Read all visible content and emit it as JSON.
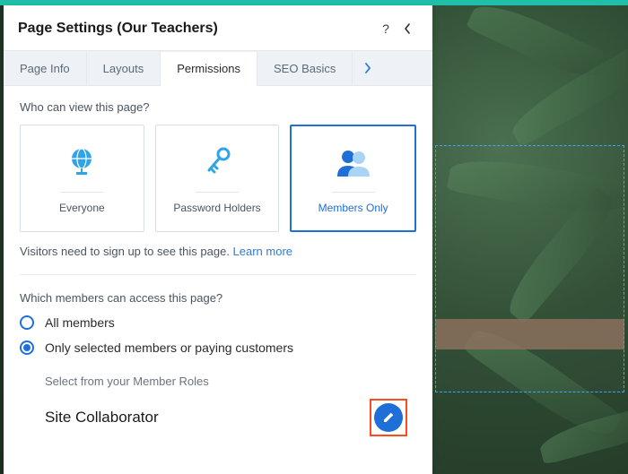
{
  "header": {
    "title": "Page Settings (Our Teachers)"
  },
  "tabs": {
    "items": [
      {
        "label": "Page Info"
      },
      {
        "label": "Layouts"
      },
      {
        "label": "Permissions"
      },
      {
        "label": "SEO Basics"
      }
    ],
    "active_index": 2
  },
  "permissions": {
    "view_question": "Who can view this page?",
    "options": [
      {
        "label": "Everyone"
      },
      {
        "label": "Password Holders"
      },
      {
        "label": "Members Only"
      }
    ],
    "selected_view_index": 2,
    "hint_prefix": "Visitors need to sign up to see this page. ",
    "hint_link": "Learn more",
    "members_question": "Which members can access this page?",
    "member_choices": {
      "all": "All members",
      "selected": "Only selected members or paying customers"
    },
    "member_choice_value": "selected",
    "roles_label": "Select from your Member Roles",
    "role_name": "Site Collaborator"
  }
}
